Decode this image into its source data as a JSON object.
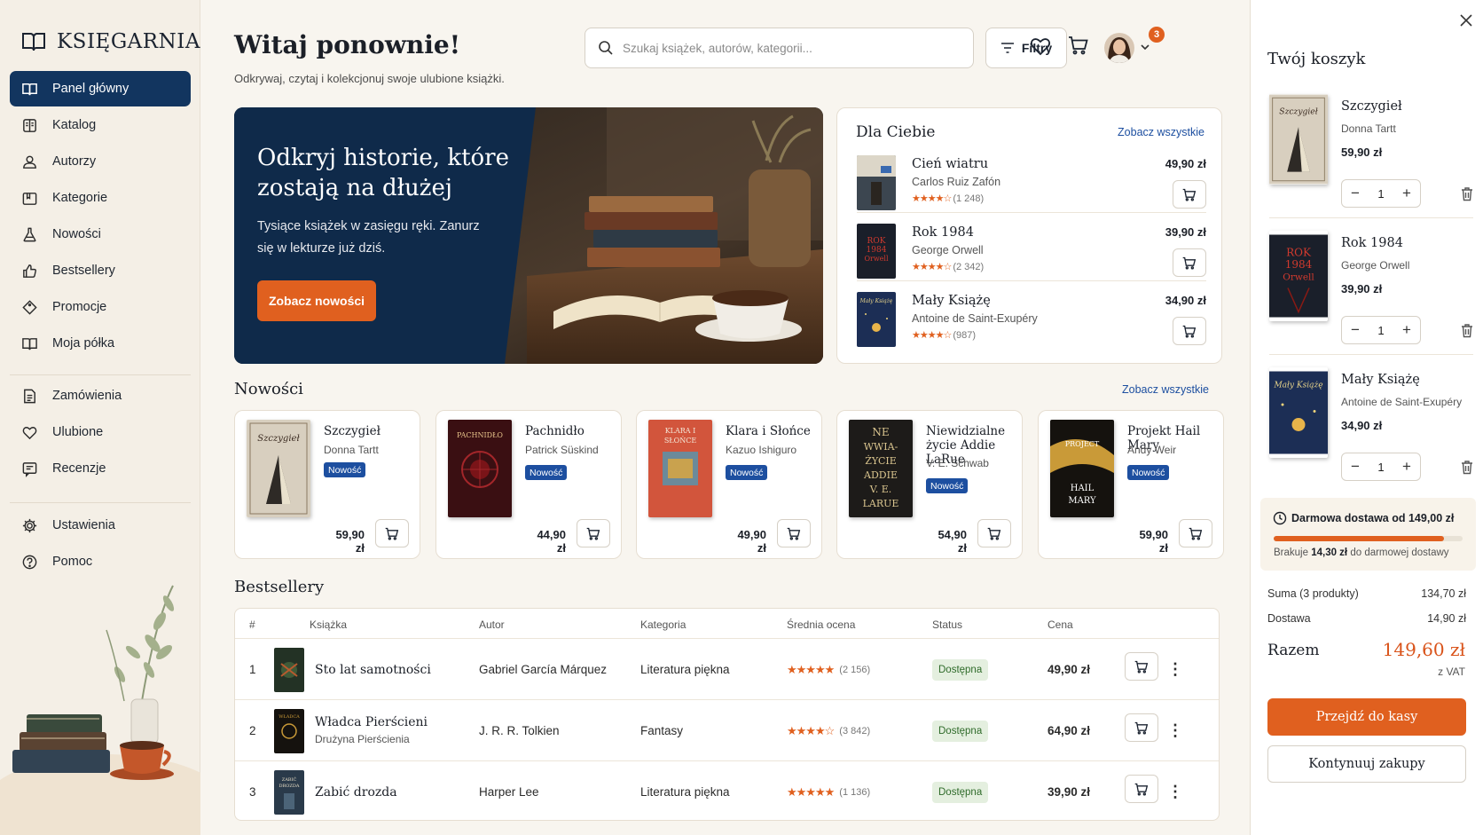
{
  "brand": {
    "name": "KSIĘGARNIA"
  },
  "sidebar": {
    "items": [
      {
        "label": "Panel główny",
        "icon": "book-open-icon",
        "active": true
      },
      {
        "label": "Katalog",
        "icon": "catalog-icon"
      },
      {
        "label": "Autorzy",
        "icon": "user-icon"
      },
      {
        "label": "Kategorie",
        "icon": "category-icon"
      },
      {
        "label": "Nowości",
        "icon": "flask-icon"
      },
      {
        "label": "Bestsellery",
        "icon": "thumbs-up-icon"
      },
      {
        "label": "Promocje",
        "icon": "tag-icon"
      },
      {
        "label": "Moja półka",
        "icon": "book-icon"
      },
      {
        "label": "Zamówienia",
        "icon": "document-icon"
      },
      {
        "label": "Ulubione",
        "icon": "heart-icon"
      },
      {
        "label": "Recenzje",
        "icon": "review-icon"
      },
      {
        "label": "Ustawienia",
        "icon": "gear-icon"
      },
      {
        "label": "Pomoc",
        "icon": "help-icon"
      }
    ]
  },
  "header": {
    "title": "Witaj ponownie!",
    "subtitle": "Odkrywaj, czytaj i kolekcjonuj swoje ulubione książki.",
    "search_placeholder": "Szukaj książek, autorów, kategorii...",
    "filters_label": "Filtry",
    "cart_count": "3"
  },
  "hero": {
    "title": "Odkryj historie, które zostają na dłużej",
    "text": "Tysiące książek w zasięgu ręki. Zanurz się w lekturze już dziś.",
    "button": "Zobacz nowości"
  },
  "for_you": {
    "title": "Dla Ciebie",
    "link": "Zobacz wszystkie",
    "items": [
      {
        "title": "Cień wiatru",
        "author": "Carlos Ruiz Zafón",
        "reviews": "(1 248)",
        "price": "49,90 zł",
        "rating": 4.5
      },
      {
        "title": "Rok 1984",
        "author": "George Orwell",
        "reviews": "(2 342)",
        "price": "39,90 zł",
        "rating": 4.5
      },
      {
        "title": "Mały Książę",
        "author": "Antoine de Saint-Exupéry",
        "reviews": "(987)",
        "price": "34,90 zł",
        "rating": 4.5
      }
    ]
  },
  "new": {
    "title": "Nowości",
    "link": "Zobacz wszystkie",
    "tag": "Nowość",
    "items": [
      {
        "title": "Szczygieł",
        "author": "Donna Tartt",
        "price": "59,90 zł",
        "cover_text": "SZCZYGIEŁ"
      },
      {
        "title": "Pachnidło",
        "author": "Patrick Süskind",
        "price": "44,90 zł",
        "cover_text": "PACHNIDŁO"
      },
      {
        "title": "Klara i Słońce",
        "author": "Kazuo Ishiguro",
        "price": "49,90 zł",
        "cover_text": "KLARA I SŁOŃCE"
      },
      {
        "title": "Niewidzialne życie Addie LaRue",
        "author": "V. E. Schwab",
        "price": "54,90 zł",
        "cover_text": "NIEWIDZIALNE ŻYCIE ADDIE LARUE"
      },
      {
        "title": "Projekt Hail Mary",
        "author": "Andy Weir",
        "price": "59,90 zł",
        "cover_text": "PROJEKT HAIL MARY"
      }
    ]
  },
  "bestsellers": {
    "title": "Bestsellery",
    "columns": [
      "#",
      "Książka",
      "Autor",
      "Kategoria",
      "Średnia ocena",
      "Status",
      "Cena"
    ],
    "rows": [
      {
        "rank": "1",
        "title": "Sto lat samotności",
        "subtitle": "",
        "author": "Gabriel García Márquez",
        "category": "Literatura piękna",
        "reviews": "(2 156)",
        "rating": 5,
        "status": "Dostępna",
        "price": "49,90 zł"
      },
      {
        "rank": "2",
        "title": "Władca Pierścieni",
        "subtitle": "Drużyna Pierścienia",
        "author": "J. R. R. Tolkien",
        "category": "Fantasy",
        "reviews": "(3 842)",
        "rating": 4.5,
        "status": "Dostępna",
        "price": "64,90 zł"
      },
      {
        "rank": "3",
        "title": "Zabić drozda",
        "subtitle": "",
        "author": "Harper Lee",
        "category": "Literatura piękna",
        "reviews": "(1 136)",
        "rating": 5,
        "status": "Dostępna",
        "price": "39,90 zł"
      }
    ]
  },
  "cart": {
    "title": "Twój koszyk",
    "items": [
      {
        "title": "Szczygieł",
        "author": "Donna Tartt",
        "price": "59,90 zł",
        "qty": "1"
      },
      {
        "title": "Rok 1984",
        "author": "George Orwell",
        "price": "39,90 zł",
        "qty": "1"
      },
      {
        "title": "Mały Książę",
        "author": "Antoine de Saint-Exupéry",
        "price": "34,90 zł",
        "qty": "1"
      }
    ],
    "free_title": "Darmowa dostawa od 149,00 zł",
    "free_missing_prefix": "Brakuje",
    "free_missing_amount": "14,30 zł",
    "free_missing_suffix": "do darmowej dostawy",
    "free_progress": 0.9,
    "sum_label": "Suma (3 produkty)",
    "sum_value": "134,70 zł",
    "delivery_label": "Dostawa",
    "delivery_value": "14,90 zł",
    "total_label": "Razem",
    "total_value": "149,60 zł",
    "vat": "z VAT",
    "checkout": "Przejdź do kasy",
    "continue": "Kontynuuj zakupy"
  },
  "colors": {
    "accent": "#e0601f",
    "primary": "#12355f",
    "link": "#1d4fa0",
    "tag": "#1d4fa0"
  }
}
